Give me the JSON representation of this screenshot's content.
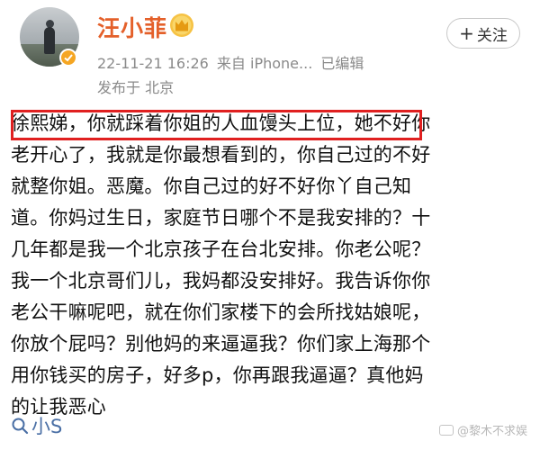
{
  "author": {
    "name": "汪小菲",
    "avatar_icon": "avatar-photo",
    "badge_icon": "verified-badge-icon",
    "crown_icon": "vip-crown-icon"
  },
  "meta": {
    "timestamp": "22-11-21 16:26",
    "source": "来自 iPhone...",
    "edited": "已编辑",
    "location": "发布于 北京"
  },
  "follow_button": {
    "plus": "+",
    "label": "关注"
  },
  "post": {
    "lines": [
      "徐熙娣，你就踩着你姐的人血馒头上位，她不好你",
      "老开心了，我就是你最想看到的，你自己过的不好",
      "就整你姐。恶魔。你自己过的好不好你丫自己知",
      "道。你妈过生日，家庭节日哪个不是我安排的？十",
      "几年都是我一个北京孩子在台北安排。你老公呢？",
      "我一个北京哥们儿，我妈都没安排好。我告诉你你",
      "老公干嘛呢吧，就在你们家楼下的会所找姑娘呢，",
      "你放个屁吗？别他妈的来逼逼我？你们家上海那个",
      "用你钱买的房子，好多p，你再跟我逼逼？真他妈",
      "的让我恶心"
    ],
    "highlighted_phrase": "徐熙娣，你就踩着你姐的人血馒头上位，"
  },
  "hashtag": {
    "icon": "search-icon",
    "text": "小S"
  },
  "watermark": {
    "text": "@黎木不求娱"
  },
  "colors": {
    "username": "#e4602a",
    "badge": "#f5a623",
    "highlight_border": "#e02020",
    "hashtag": "#4a6fa5",
    "meta_text": "#8a8a8a"
  }
}
